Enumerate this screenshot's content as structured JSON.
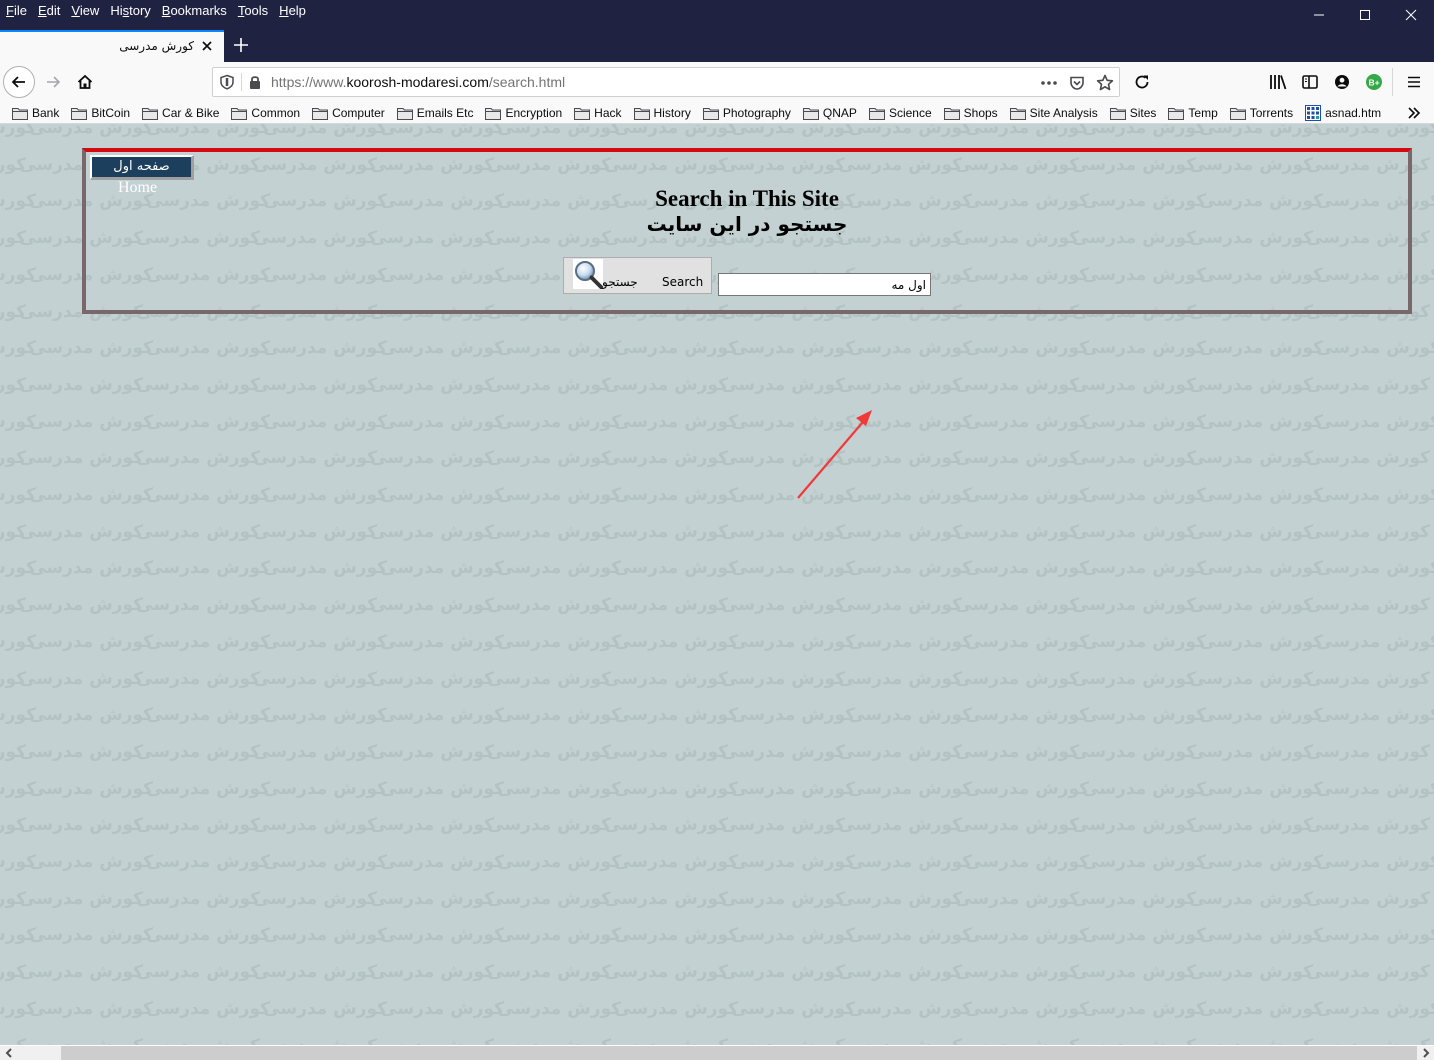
{
  "menubar": {
    "items": [
      {
        "label": "File",
        "accel": "F",
        "rest": "ile"
      },
      {
        "label": "Edit",
        "accel": "E",
        "rest": "dit"
      },
      {
        "label": "View",
        "accel": "V",
        "rest": "iew"
      },
      {
        "label": "History",
        "pre": "Hi",
        "accel": "s",
        "rest": "tory"
      },
      {
        "label": "Bookmarks",
        "accel": "B",
        "rest": "ookmarks"
      },
      {
        "label": "Tools",
        "accel": "T",
        "rest": "ools"
      },
      {
        "label": "Help",
        "accel": "H",
        "rest": "elp"
      }
    ],
    "window_controls": [
      "minimize-icon",
      "maximize-icon",
      "close-icon"
    ]
  },
  "tabs": [
    {
      "title": "کورش مدرسی",
      "active": true
    }
  ],
  "navbar": {
    "url_prefix": "https://www.",
    "url_host": "koorosh-modaresi.com",
    "url_path": "/search.html",
    "icons": [
      "back-icon",
      "forward-icon",
      "home-icon",
      "shield-icon",
      "lock-icon",
      "more-icon",
      "pocket-icon",
      "star-icon",
      "reload-icon",
      "library-icon",
      "sidebar-icon",
      "account-icon",
      "extension-icon",
      "hamburger-menu-icon"
    ],
    "extension_badge": "B+"
  },
  "bookmarks": [
    {
      "label": "Bank",
      "type": "folder"
    },
    {
      "label": "BitCoin",
      "type": "folder"
    },
    {
      "label": "Car & Bike",
      "type": "folder"
    },
    {
      "label": "Common",
      "type": "folder"
    },
    {
      "label": "Computer",
      "type": "folder"
    },
    {
      "label": "Emails Etc",
      "type": "folder"
    },
    {
      "label": "Encryption",
      "type": "folder"
    },
    {
      "label": "Hack",
      "type": "folder"
    },
    {
      "label": "History",
      "type": "folder"
    },
    {
      "label": "Photography",
      "type": "folder"
    },
    {
      "label": "QNAP",
      "type": "folder"
    },
    {
      "label": "Science",
      "type": "folder"
    },
    {
      "label": "Shops",
      "type": "folder"
    },
    {
      "label": "Site Analysis",
      "type": "folder"
    },
    {
      "label": "Sites",
      "type": "folder"
    },
    {
      "label": "Temp",
      "type": "folder"
    },
    {
      "label": "Torrents",
      "type": "folder"
    },
    {
      "label": "asnad.htm",
      "type": "page"
    }
  ],
  "page": {
    "watermark_text": "کورش مدرسی",
    "home_button_fa": "صفحه اول",
    "home_button_en": "Home",
    "title_en": "Search in This Site",
    "title_fa": "جستجو در این سایت",
    "search_button_fa": "جستجو",
    "search_button_en": "Search",
    "search_input_value": "اول مه",
    "colors": {
      "background": "#c3d1d2",
      "panel_top_border": "#d40a10",
      "panel_border": "#786869",
      "home_button": "#1b3f5c",
      "annotation_arrow": "#f03a3a"
    }
  }
}
